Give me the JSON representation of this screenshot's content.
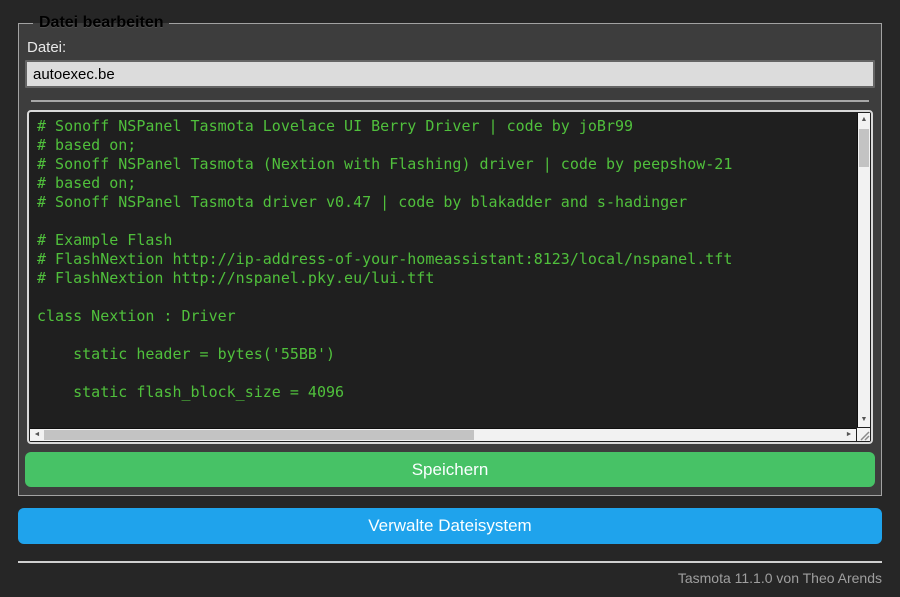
{
  "page": {
    "footer": {
      "version_text": "Tasmota 11.1.0 von Theo Arends"
    }
  },
  "form": {
    "legend": "Datei bearbeiten",
    "file_label": "Datei:",
    "file_input_value": "autoexec.be",
    "save_button": "Speichern"
  },
  "editor": {
    "code": "# Sonoff NSPanel Tasmota Lovelace UI Berry Driver | code by joBr99\n# based on;\n# Sonoff NSPanel Tasmota (Nextion with Flashing) driver | code by peepshow-21\n# based on;\n# Sonoff NSPanel Tasmota driver v0.47 | code by blakadder and s-hadinger\n\n# Example Flash\n# FlashNextion http://ip-address-of-your-homeassistant:8123/local/nspanel.tft\n# FlashNextion http://nspanel.pky.eu/lui.tft\n\nclass Nextion : Driver\n\n    static header = bytes('55BB')\n\n    static flash_block_size = 4096"
  },
  "buttons": {
    "manage_fs": "Verwalte Dateisystem"
  },
  "icons": {
    "scroll_up": "▲",
    "scroll_down": "▼",
    "scroll_left": "◄",
    "scroll_right": "►"
  },
  "colors": {
    "save_button_green": "#47c266",
    "manage_button_blue": "#1fa3ec",
    "console_text_green": "#50c03c",
    "console_background": "#1f1f1f",
    "form_background": "#3d3d3d",
    "page_background": "#262626",
    "input_background": "#dcdcdc"
  }
}
